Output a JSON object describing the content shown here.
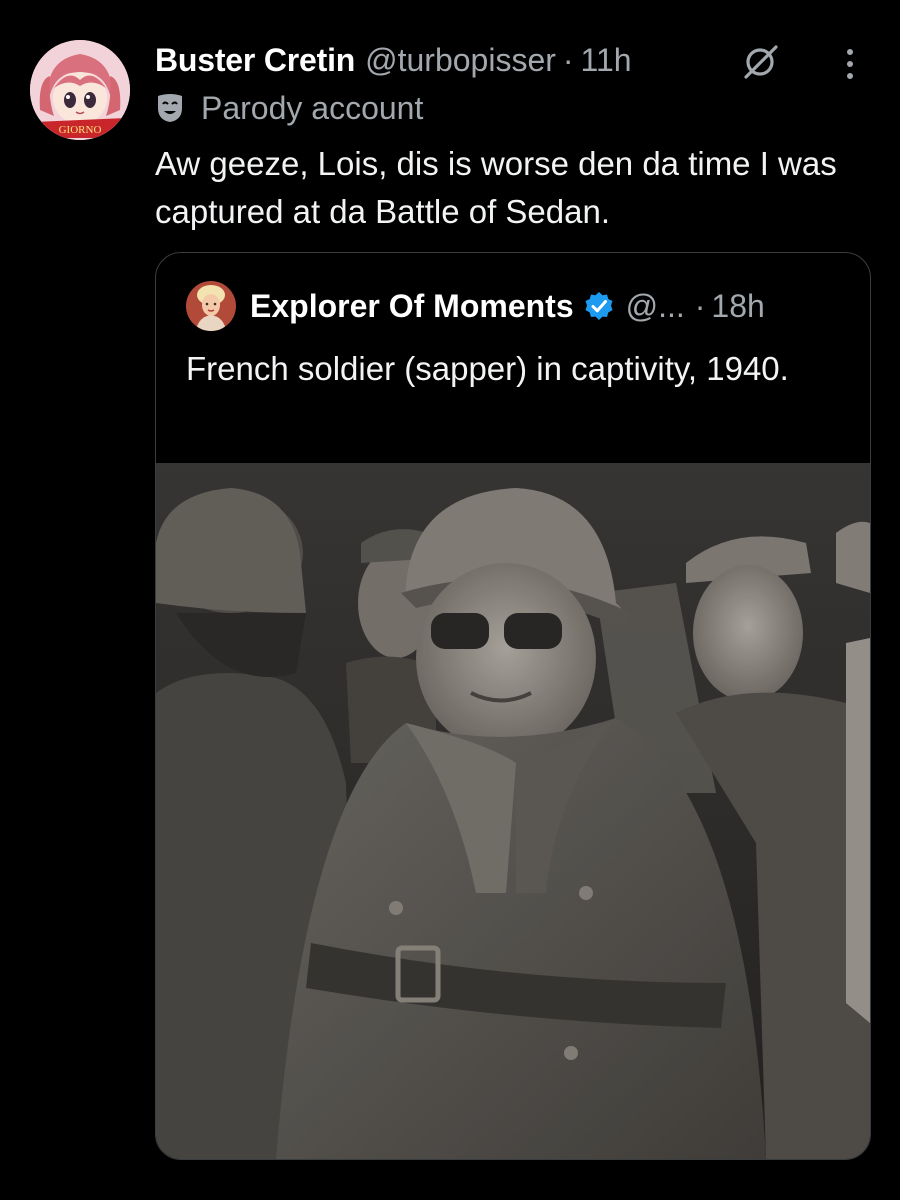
{
  "tweet": {
    "author_name": "Buster Cretin",
    "author_handle": "@turbopisser",
    "separator": "·",
    "time": "11h",
    "account_label": "Parody account",
    "avatar_caption": "GIORNO",
    "text": "Aw geeze, Lois, dis is worse den da time I was captured at da Battle of Sedan.",
    "icons": {
      "grok": "grok-icon",
      "more": "more-vertical-icon",
      "mask": "theater-mask-icon"
    }
  },
  "quoted_tweet": {
    "author_name": "Explorer Of Moments",
    "author_handle": "@...",
    "separator": "·",
    "time": "18h",
    "text": "French soldier (sapper) in captivity, 1940.",
    "verified": true,
    "icons": {
      "verified": "verified-badge-icon"
    }
  },
  "colors": {
    "background": "#000000",
    "text": "#e7e9ea",
    "muted": "#a2a8ad",
    "verified": "#1d9bf0",
    "border": "#3a3d41"
  }
}
